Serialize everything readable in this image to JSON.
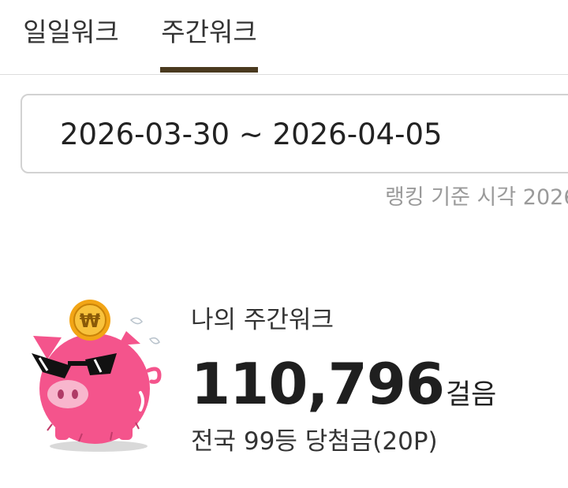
{
  "tabs": [
    {
      "label": "일일워크",
      "selected": false
    },
    {
      "label": "주간워크",
      "selected": true
    }
  ],
  "date_range": "2026-03-30 ~ 2026-04-05",
  "ranking_time": "랭킹 기준 시각 2026",
  "my_weekly": {
    "label": "나의 주간워크",
    "steps": "110,796",
    "steps_unit": "걸음",
    "rank_info": "전국 99등 당첨금(20P)"
  },
  "mascot": {
    "coin_symbol": "₩",
    "icon": "piggy-bank-sunglasses-icon"
  },
  "colors": {
    "accent_underline": "#4a3a1f",
    "pig_pink": "#f4548c",
    "coin_gold": "#f2a516"
  }
}
